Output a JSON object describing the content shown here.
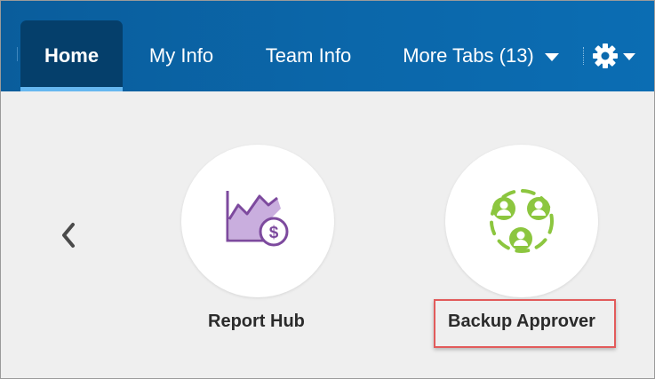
{
  "nav": {
    "tabs": [
      {
        "label": "Home",
        "active": true
      },
      {
        "label": "My Info",
        "active": false
      },
      {
        "label": "Team Info",
        "active": false
      },
      {
        "label": "More Tabs (13)",
        "active": false
      }
    ],
    "settings_icon": "gear-icon",
    "dropdown_icon": "caret-down-icon"
  },
  "carousel": {
    "prev_icon": "chevron-left-icon",
    "tiles": [
      {
        "label": "Report Hub",
        "icon": "chart-dollar-icon"
      },
      {
        "label": "Backup Approver",
        "icon": "people-cycle-icon"
      }
    ],
    "highlighted_tile": "Backup Approver"
  },
  "colors": {
    "nav_bg": "#0b67aa",
    "active_tab_bg": "#053f6b",
    "active_tab_underline": "#66b7f0",
    "content_bg": "#efefef",
    "report_icon": "#7d4a9e",
    "backup_icon": "#8cc63f",
    "highlight": "#e25b5b"
  }
}
